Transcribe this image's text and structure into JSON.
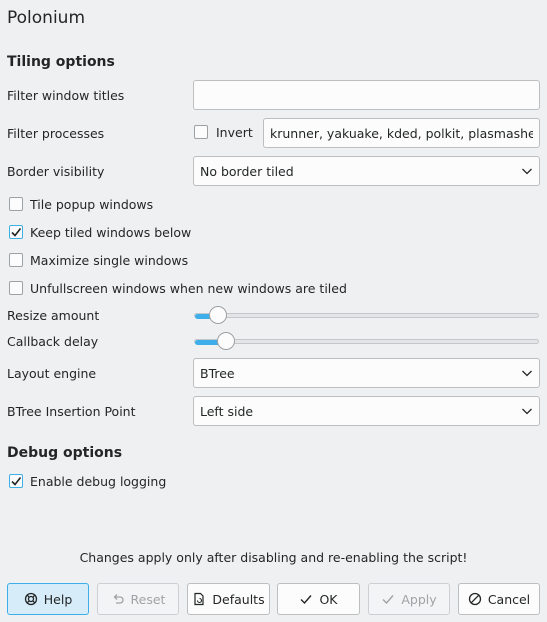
{
  "window": {
    "title": "Polonium"
  },
  "tiling": {
    "heading": "Tiling options",
    "filter_titles": {
      "label": "Filter window titles",
      "value": "",
      "placeholder": ""
    },
    "filter_processes": {
      "label": "Filter processes",
      "invert_label": "Invert",
      "invert_checked": false,
      "value": "krunner, yakuake, kded, polkit, plasmashell"
    },
    "border_visibility": {
      "label": "Border visibility",
      "selected": "No border tiled"
    },
    "tile_popup": {
      "label": "Tile popup windows",
      "checked": false
    },
    "keep_below": {
      "label": "Keep tiled windows below",
      "checked": true
    },
    "maximize_single": {
      "label": "Maximize single windows",
      "checked": false
    },
    "unfullscreen": {
      "label": "Unfullscreen windows when new windows are tiled",
      "checked": false
    },
    "resize_amount": {
      "label": "Resize amount",
      "level": 0.04
    },
    "callback_delay": {
      "label": "Callback delay",
      "level": 0.065
    },
    "layout_engine": {
      "label": "Layout engine",
      "selected": "BTree"
    },
    "btree_insertion": {
      "label": "BTree Insertion Point",
      "selected": "Left side"
    }
  },
  "debug": {
    "heading": "Debug options",
    "enable_logging": {
      "label": "Enable debug logging",
      "checked": true
    }
  },
  "notice": "Changes apply only after disabling and re-enabling the script!",
  "buttons": {
    "help": "Help",
    "reset": "Reset",
    "defaults": "Defaults",
    "ok": "OK",
    "apply": "Apply",
    "cancel": "Cancel"
  },
  "colors": {
    "accent": "#3daee9",
    "background": "#eff0f1",
    "text": "#232627"
  }
}
